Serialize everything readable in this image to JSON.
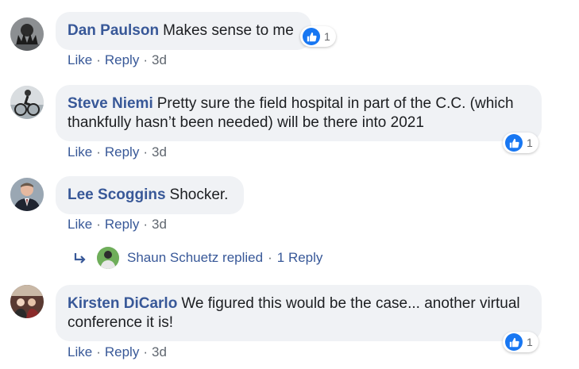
{
  "comments": [
    {
      "author": "Dan Paulson",
      "text": "Makes sense to me",
      "like": "Like",
      "reply": "Reply",
      "time": "3d",
      "reactions": "1",
      "avatar": "hands-avatar-icon"
    },
    {
      "author": "Steve Niemi",
      "text": "Pretty sure the field hospital in part of the C.C. (which thankfully hasn’t been needed) will be there into 2021",
      "like": "Like",
      "reply": "Reply",
      "time": "3d",
      "reactions": "1",
      "avatar": "cyclist-avatar-icon"
    },
    {
      "author": "Lee Scoggins",
      "text": "Shocker.",
      "like": "Like",
      "reply": "Reply",
      "time": "3d",
      "avatar": "man-suit-avatar-icon"
    },
    {
      "author": "Kirsten DiCarlo",
      "text": "We figured this would be the case... another virtual conference it is!",
      "like": "Like",
      "reply": "Reply",
      "time": "3d",
      "reactions": "1",
      "avatar": "group-photo-avatar-icon"
    }
  ],
  "reply_summary": {
    "name": "Shaun Schuetz",
    "action": "replied",
    "sep": "·",
    "count": "1 Reply",
    "icon": "reply-arrow-icon"
  },
  "colors": {
    "link": "#385898",
    "bubble": "#f0f2f5",
    "like_badge": "#1877f2",
    "muted": "#606770"
  }
}
